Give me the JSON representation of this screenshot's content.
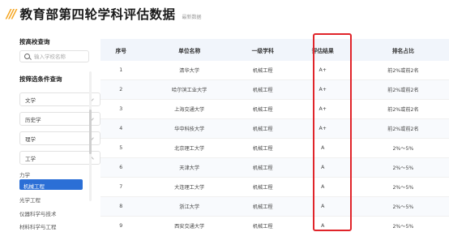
{
  "header": {
    "title": "教育部第四轮学科评估数据",
    "subtitle": "最新数据"
  },
  "sidebar": {
    "school_query_heading": "按高校查询",
    "search_placeholder": "输入学校名称",
    "filter_heading": "按筛选条件查询",
    "categories": [
      {
        "label": "文学",
        "expanded": false
      },
      {
        "label": "历史学",
        "expanded": false
      },
      {
        "label": "理学",
        "expanded": false
      },
      {
        "label": "工学",
        "expanded": true
      }
    ],
    "subcategories": [
      {
        "label": "力学",
        "active": false
      },
      {
        "label": "机械工程",
        "active": true
      },
      {
        "label": "光学工程",
        "active": false
      },
      {
        "label": "仪器科学与技术",
        "active": false
      },
      {
        "label": "材料科学与工程",
        "active": false
      }
    ]
  },
  "table": {
    "columns": [
      "序号",
      "单位名称",
      "一级学科",
      "评估结果",
      "排名占比"
    ],
    "rows": [
      [
        "1",
        "清华大学",
        "机械工程",
        "A+",
        "前2%或前2名"
      ],
      [
        "2",
        "哈尔滨工业大学",
        "机械工程",
        "A+",
        "前2%或前2名"
      ],
      [
        "3",
        "上海交通大学",
        "机械工程",
        "A+",
        "前2%或前2名"
      ],
      [
        "4",
        "华中科技大学",
        "机械工程",
        "A+",
        "前2%或前2名"
      ],
      [
        "5",
        "北京理工大学",
        "机械工程",
        "A",
        "2%～5%"
      ],
      [
        "6",
        "天津大学",
        "机械工程",
        "A",
        "2%～5%"
      ],
      [
        "7",
        "大连理工大学",
        "机械工程",
        "A",
        "2%～5%"
      ],
      [
        "8",
        "浙江大学",
        "机械工程",
        "A",
        "2%～5%"
      ],
      [
        "9",
        "西安交通大学",
        "机械工程",
        "A",
        "2%～5%"
      ]
    ]
  },
  "colors": {
    "accent": "#2b6fd6",
    "title_slash": "#f5a623",
    "highlight_border": "#e0242a",
    "header_bg": "#f1f5fb"
  }
}
